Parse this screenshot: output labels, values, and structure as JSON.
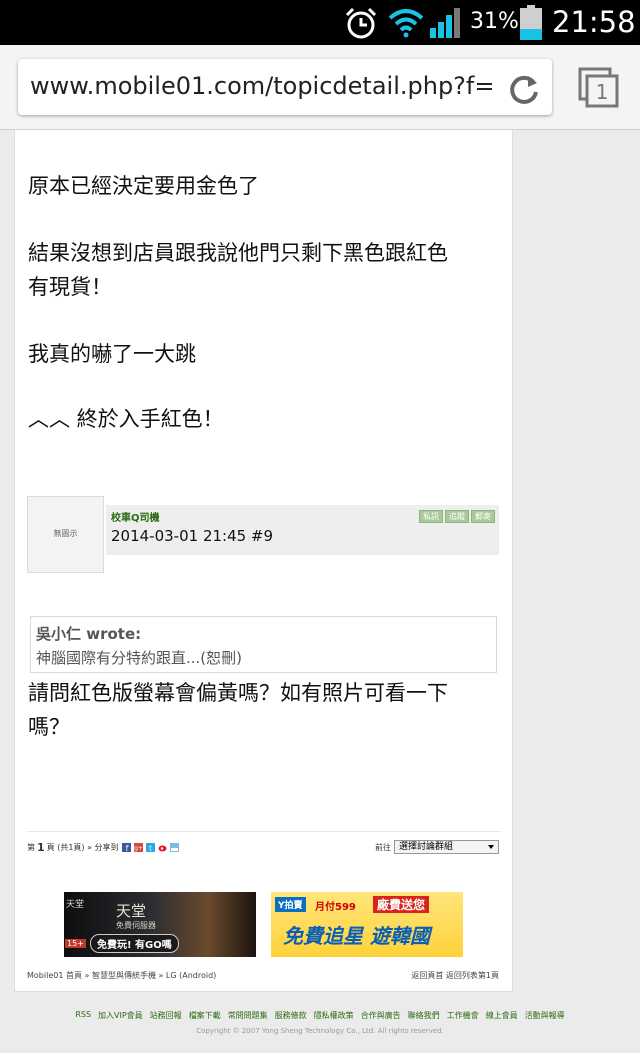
{
  "status": {
    "battery_percent": "31%",
    "time": "21:58"
  },
  "browser": {
    "url": "www.mobile01.com/topicdetail.php?f="
  },
  "post1": {
    "line1": "原本已經決定要用金色了",
    "line2a": "結果沒想到店員跟我說他門只剩下黑色跟紅色",
    "line2b": "有現貨！",
    "line3": "我真的嚇了一大跳",
    "line4": "︿︿ 終於入手紅色！"
  },
  "post2": {
    "avatar_text": "無圖示",
    "author": "校車Q司機",
    "buttons": [
      "私訊",
      "追蹤",
      "郵寄"
    ],
    "date_line": "2014-03-01 21:45  #9",
    "quote_author": "吳小仁 wrote:",
    "quote_text": "神腦國際有分特約跟直...(恕刪)",
    "body_a": "請問紅色版螢幕會偏黃嗎？如有照片可看一下",
    "body_b": "嗎？"
  },
  "pager": {
    "prefix": "第",
    "current": "1",
    "suffix": "頁 (共1頁) » 分享到",
    "goto_label": "前往",
    "select_value": "選擇討論群組"
  },
  "ads": {
    "ad1": {
      "corner": "天堂",
      "title": "天堂",
      "sub": "免費伺服器",
      "cta": "免費玩! 有GO嗎",
      "age": "15+"
    },
    "ad2": {
      "logo": "Y拍賣",
      "promo_a": "月付599",
      "promo_b": "廠費送您",
      "title": "免費追星 遊韓國"
    }
  },
  "breadcrumb": "Mobile01 首頁 » 智慧型與傳統手機 » LG (Android)",
  "back_links": "返回頁首  返回列表第1頁",
  "footer": {
    "links": [
      "RSS",
      "加入VIP會員",
      "站務回報",
      "檔案下載",
      "常問問題集",
      "服務條款",
      "隱私權政策",
      "合作與廣告",
      "聯絡我們",
      "工作機會",
      "線上會員",
      "活動與報導"
    ],
    "copyright": "Copyright © 2007 Yong Sheng Technology Co., Ltd. All rights reserved."
  },
  "icons": [
    "alarm-icon",
    "wifi-icon",
    "signal-icon",
    "battery-icon",
    "reload-icon",
    "tabs-icon",
    "facebook-icon",
    "googleplus-icon",
    "twitter-icon",
    "weibo-icon",
    "plurk-icon"
  ]
}
